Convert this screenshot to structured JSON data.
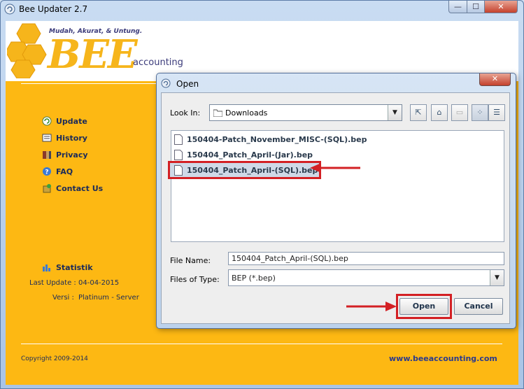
{
  "window": {
    "title": "Bee Updater 2.7",
    "min": "—",
    "max": "☐",
    "close": "✕"
  },
  "brand": {
    "tagline": "Mudah, Akurat, & Untung.",
    "word": "BEE",
    "sub": "accounting"
  },
  "nav": {
    "items": [
      {
        "label": "Update",
        "icon": "update-icon"
      },
      {
        "label": "History",
        "icon": "history-icon"
      },
      {
        "label": "Privacy",
        "icon": "privacy-icon"
      },
      {
        "label": "FAQ",
        "icon": "faq-icon"
      },
      {
        "label": "Contact Us",
        "icon": "contact-icon"
      }
    ]
  },
  "stats": {
    "label": "Statistik",
    "last_update_label": "Last Update :",
    "last_update_value": "04-04-2015",
    "version_label": "Versi :",
    "version_value": "Platinum - Server"
  },
  "footer": {
    "copyright": "Copyright 2009-2014",
    "link": "www.beeaccounting.com"
  },
  "dialog": {
    "title": "Open",
    "close": "✕",
    "look_in_label": "Look In:",
    "look_in_value": "Downloads",
    "files": [
      "150404-Patch_November_MISC-(SQL).bep",
      "150404_Patch_April-(Jar).bep",
      "150404_Patch_April-(SQL).bep"
    ],
    "selected_index": 2,
    "file_name_label": "File Name:",
    "file_name_value": "150404_Patch_April-(SQL).bep",
    "files_of_type_label": "Files of Type:",
    "files_of_type_value": "BEP (*.bep)",
    "open_button": "Open",
    "cancel_button": "Cancel"
  },
  "colors": {
    "accent": "#fdb813",
    "highlight": "#d32024",
    "text_dark": "#1a2a5a"
  }
}
